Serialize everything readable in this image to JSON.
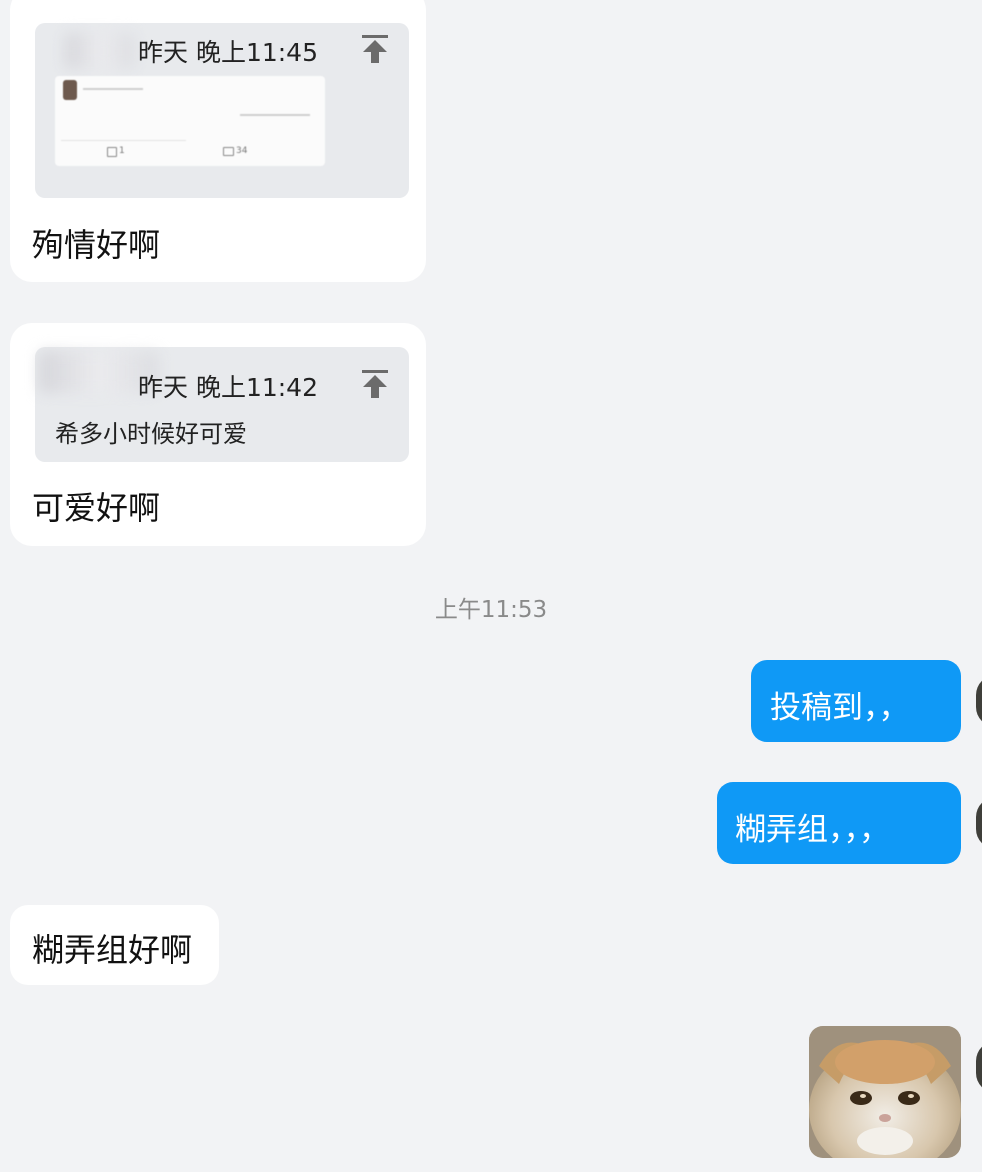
{
  "conversation": {
    "messages": [
      {
        "quote": {
          "time_label": "昨天 晚上11:45",
          "shared_post": {
            "repost_count": "1",
            "comment_count": "34"
          }
        },
        "text": "殉情好啊"
      },
      {
        "quote": {
          "time_label": "昨天 晚上11:42",
          "text": "希多小时候好可爱"
        },
        "text": "可爱好啊"
      }
    ],
    "timestamp": "上午11:53",
    "outgoing": [
      {
        "text": "投稿到，，"
      },
      {
        "text": "糊弄组，，，"
      }
    ],
    "incoming_after": {
      "text": "糊弄组好啊"
    }
  },
  "colors": {
    "background": "#f2f3f5",
    "incoming_bubble": "#ffffff",
    "outgoing_bubble": "#0f99f6",
    "quote_background": "#e8eaed"
  },
  "icons": {
    "quote_jump": "arrow-up-to-top-icon",
    "repost": "share-edit-icon",
    "comment": "comment-icon"
  }
}
